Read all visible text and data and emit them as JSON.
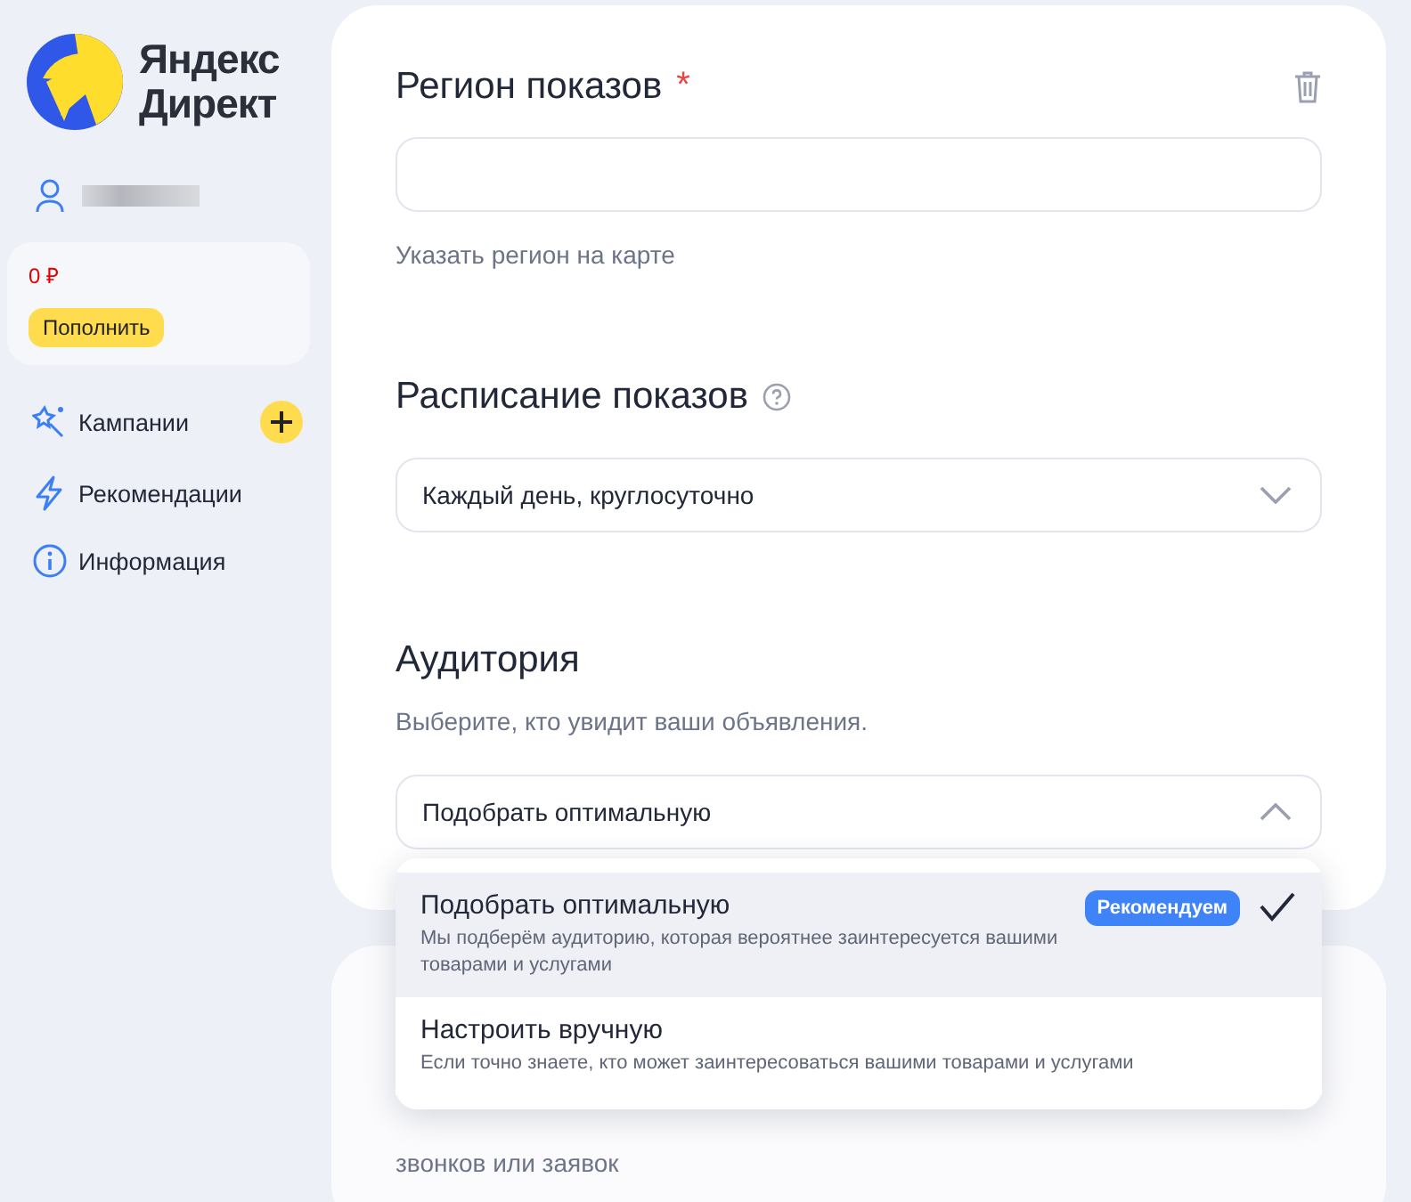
{
  "sidebar": {
    "logo": {
      "line1": "Яндекс",
      "line2": "Директ"
    },
    "balance": {
      "amount": "0 ₽",
      "button": "Пополнить"
    },
    "nav": [
      {
        "label": "Кампании",
        "add_button": true
      },
      {
        "label": "Рекомендации",
        "add_button": false
      },
      {
        "label": "Информация",
        "add_button": false
      }
    ]
  },
  "region": {
    "title": "Регион показов",
    "required_mark": "*",
    "map_link": "Указать регион на карте"
  },
  "schedule": {
    "title": "Расписание показов",
    "value": "Каждый день, круглосуточно",
    "expanded": false
  },
  "audience": {
    "title": "Аудитория",
    "description": "Выберите, кто увидит ваши объявления.",
    "value": "Подобрать оптимальную",
    "expanded": true,
    "options": [
      {
        "title": "Подобрать оптимальную",
        "description": "Мы подберём аудиторию, которая вероятнее заинтересуется вашими товарами и услугами",
        "badge": "Рекомендуем",
        "selected": true
      },
      {
        "title": "Настроить вручную",
        "description": "Если точно знаете, кто может заинтересоваться вашими товарами и услугами",
        "selected": false
      }
    ]
  },
  "next_card": {
    "text": "звонков или заявок"
  }
}
